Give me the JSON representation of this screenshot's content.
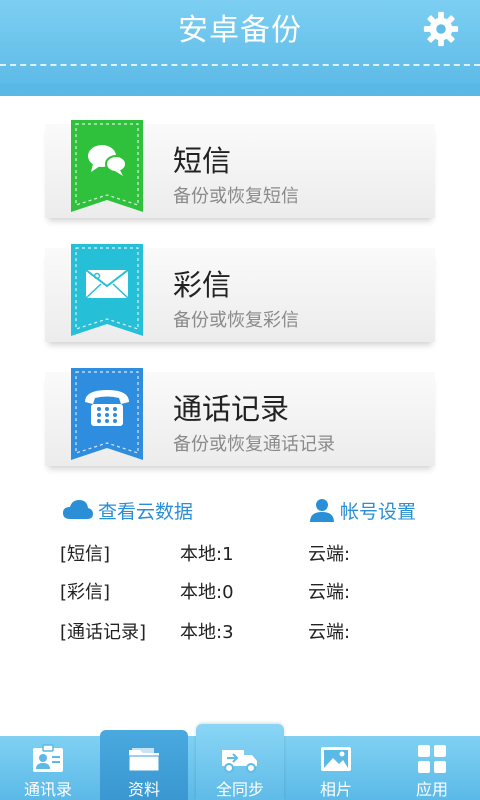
{
  "header": {
    "title": "安卓备份",
    "settings_icon": "gear-icon"
  },
  "cards": [
    {
      "title": "短信",
      "subtitle": "备份或恢复短信",
      "icon": "sms-chat-icon",
      "color": "#2fc13c"
    },
    {
      "title": "彩信",
      "subtitle": "备份或恢复彩信",
      "icon": "mms-envelope-icon",
      "color": "#25c0d8"
    },
    {
      "title": "通话记录",
      "subtitle": "备份或恢复通话记录",
      "icon": "phone-keypad-icon",
      "color": "#2f8de0"
    }
  ],
  "links": {
    "cloud_view": "查看云数据",
    "account": "帐号设置"
  },
  "stats": [
    {
      "label": "[短信]",
      "local": "本地:1",
      "cloud": "云端:"
    },
    {
      "label": "[彩信]",
      "local": "本地:0",
      "cloud": "云端:"
    },
    {
      "label": "[通话记录]",
      "local": "本地:3",
      "cloud": "云端:"
    }
  ],
  "tabs": [
    {
      "label": "通讯录",
      "icon": "contacts-card-icon"
    },
    {
      "label": "资料",
      "icon": "folder-icon",
      "selected": true
    },
    {
      "label": "全同步",
      "icon": "sync-truck-icon"
    },
    {
      "label": "相片",
      "icon": "photo-icon"
    },
    {
      "label": "应用",
      "icon": "apps-grid-icon"
    }
  ],
  "colors": {
    "header": "#6cc5ee",
    "link": "#2a8fd6",
    "tab_selected": "#3f9fd8"
  }
}
